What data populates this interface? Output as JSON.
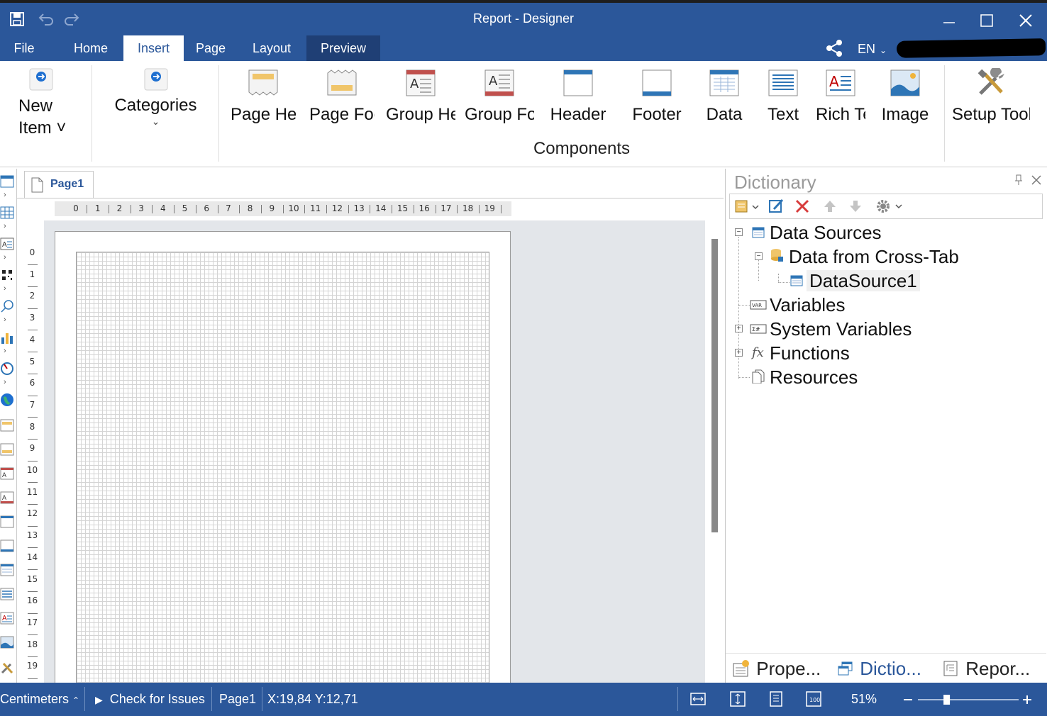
{
  "window": {
    "title": "Report - Designer"
  },
  "tabs": [
    {
      "label": "File"
    },
    {
      "label": "Home"
    },
    {
      "label": "Insert",
      "active": true
    },
    {
      "label": "Page"
    },
    {
      "label": "Layout"
    },
    {
      "label": "Preview"
    }
  ],
  "language": "EN",
  "ribbon": {
    "new_item": "New Item",
    "categories": "Categories",
    "group_caption": "Components",
    "buttons": [
      {
        "label": "Page Header",
        "icon": "page-header-icon"
      },
      {
        "label": "Page Footer",
        "icon": "page-footer-icon"
      },
      {
        "label": "Group Header",
        "icon": "group-header-icon"
      },
      {
        "label": "Group Footer",
        "icon": "group-footer-icon"
      },
      {
        "label": "Header",
        "icon": "header-band-icon"
      },
      {
        "label": "Footer",
        "icon": "footer-band-icon"
      },
      {
        "label": "Data",
        "icon": "data-band-icon"
      },
      {
        "label": "Text",
        "icon": "text-icon"
      },
      {
        "label": "Rich Text",
        "icon": "rich-text-icon"
      },
      {
        "label": "Image",
        "icon": "image-icon"
      },
      {
        "label": "Setup Toolbox",
        "icon": "tools-icon"
      }
    ]
  },
  "designer": {
    "page_tab": "Page1",
    "hruler": [
      "0",
      "1",
      "2",
      "3",
      "4",
      "5",
      "6",
      "7",
      "8",
      "9",
      "10",
      "11",
      "12",
      "13",
      "14",
      "15",
      "16",
      "17",
      "18",
      "19"
    ],
    "vruler": [
      "0",
      "1",
      "2",
      "3",
      "4",
      "5",
      "6",
      "7",
      "8",
      "9",
      "10",
      "11",
      "12",
      "13",
      "14",
      "15",
      "16",
      "17",
      "18",
      "19"
    ]
  },
  "dictionary": {
    "title": "Dictionary",
    "tree": [
      {
        "label": "Data Sources",
        "icon": "datasource-icon"
      },
      {
        "label": "Data from Cross-Tab",
        "icon": "database-icon"
      },
      {
        "label": "DataSource1",
        "icon": "table-icon",
        "selected": true
      },
      {
        "label": "Variables",
        "icon": "variables-icon"
      },
      {
        "label": "System Variables",
        "icon": "system-variables-icon"
      },
      {
        "label": "Functions",
        "icon": "function-icon"
      },
      {
        "label": "Resources",
        "icon": "resources-icon"
      }
    ],
    "bottom_tabs": [
      {
        "label": "Prope...",
        "icon": "properties-icon"
      },
      {
        "label": "Dictio...",
        "icon": "dictionary-icon",
        "active": true
      },
      {
        "label": "Repor...",
        "icon": "report-tree-icon"
      }
    ]
  },
  "status": {
    "units": "Centimeters",
    "check": "Check for Issues",
    "page": "Page1",
    "coords": "X:19,84 Y:12,71",
    "zoom": "51%",
    "zoom_level": 0.51
  },
  "colors": {
    "brand": "#2b579a",
    "preview_tab": "#1f3f75",
    "delete": "#d83b3b"
  }
}
